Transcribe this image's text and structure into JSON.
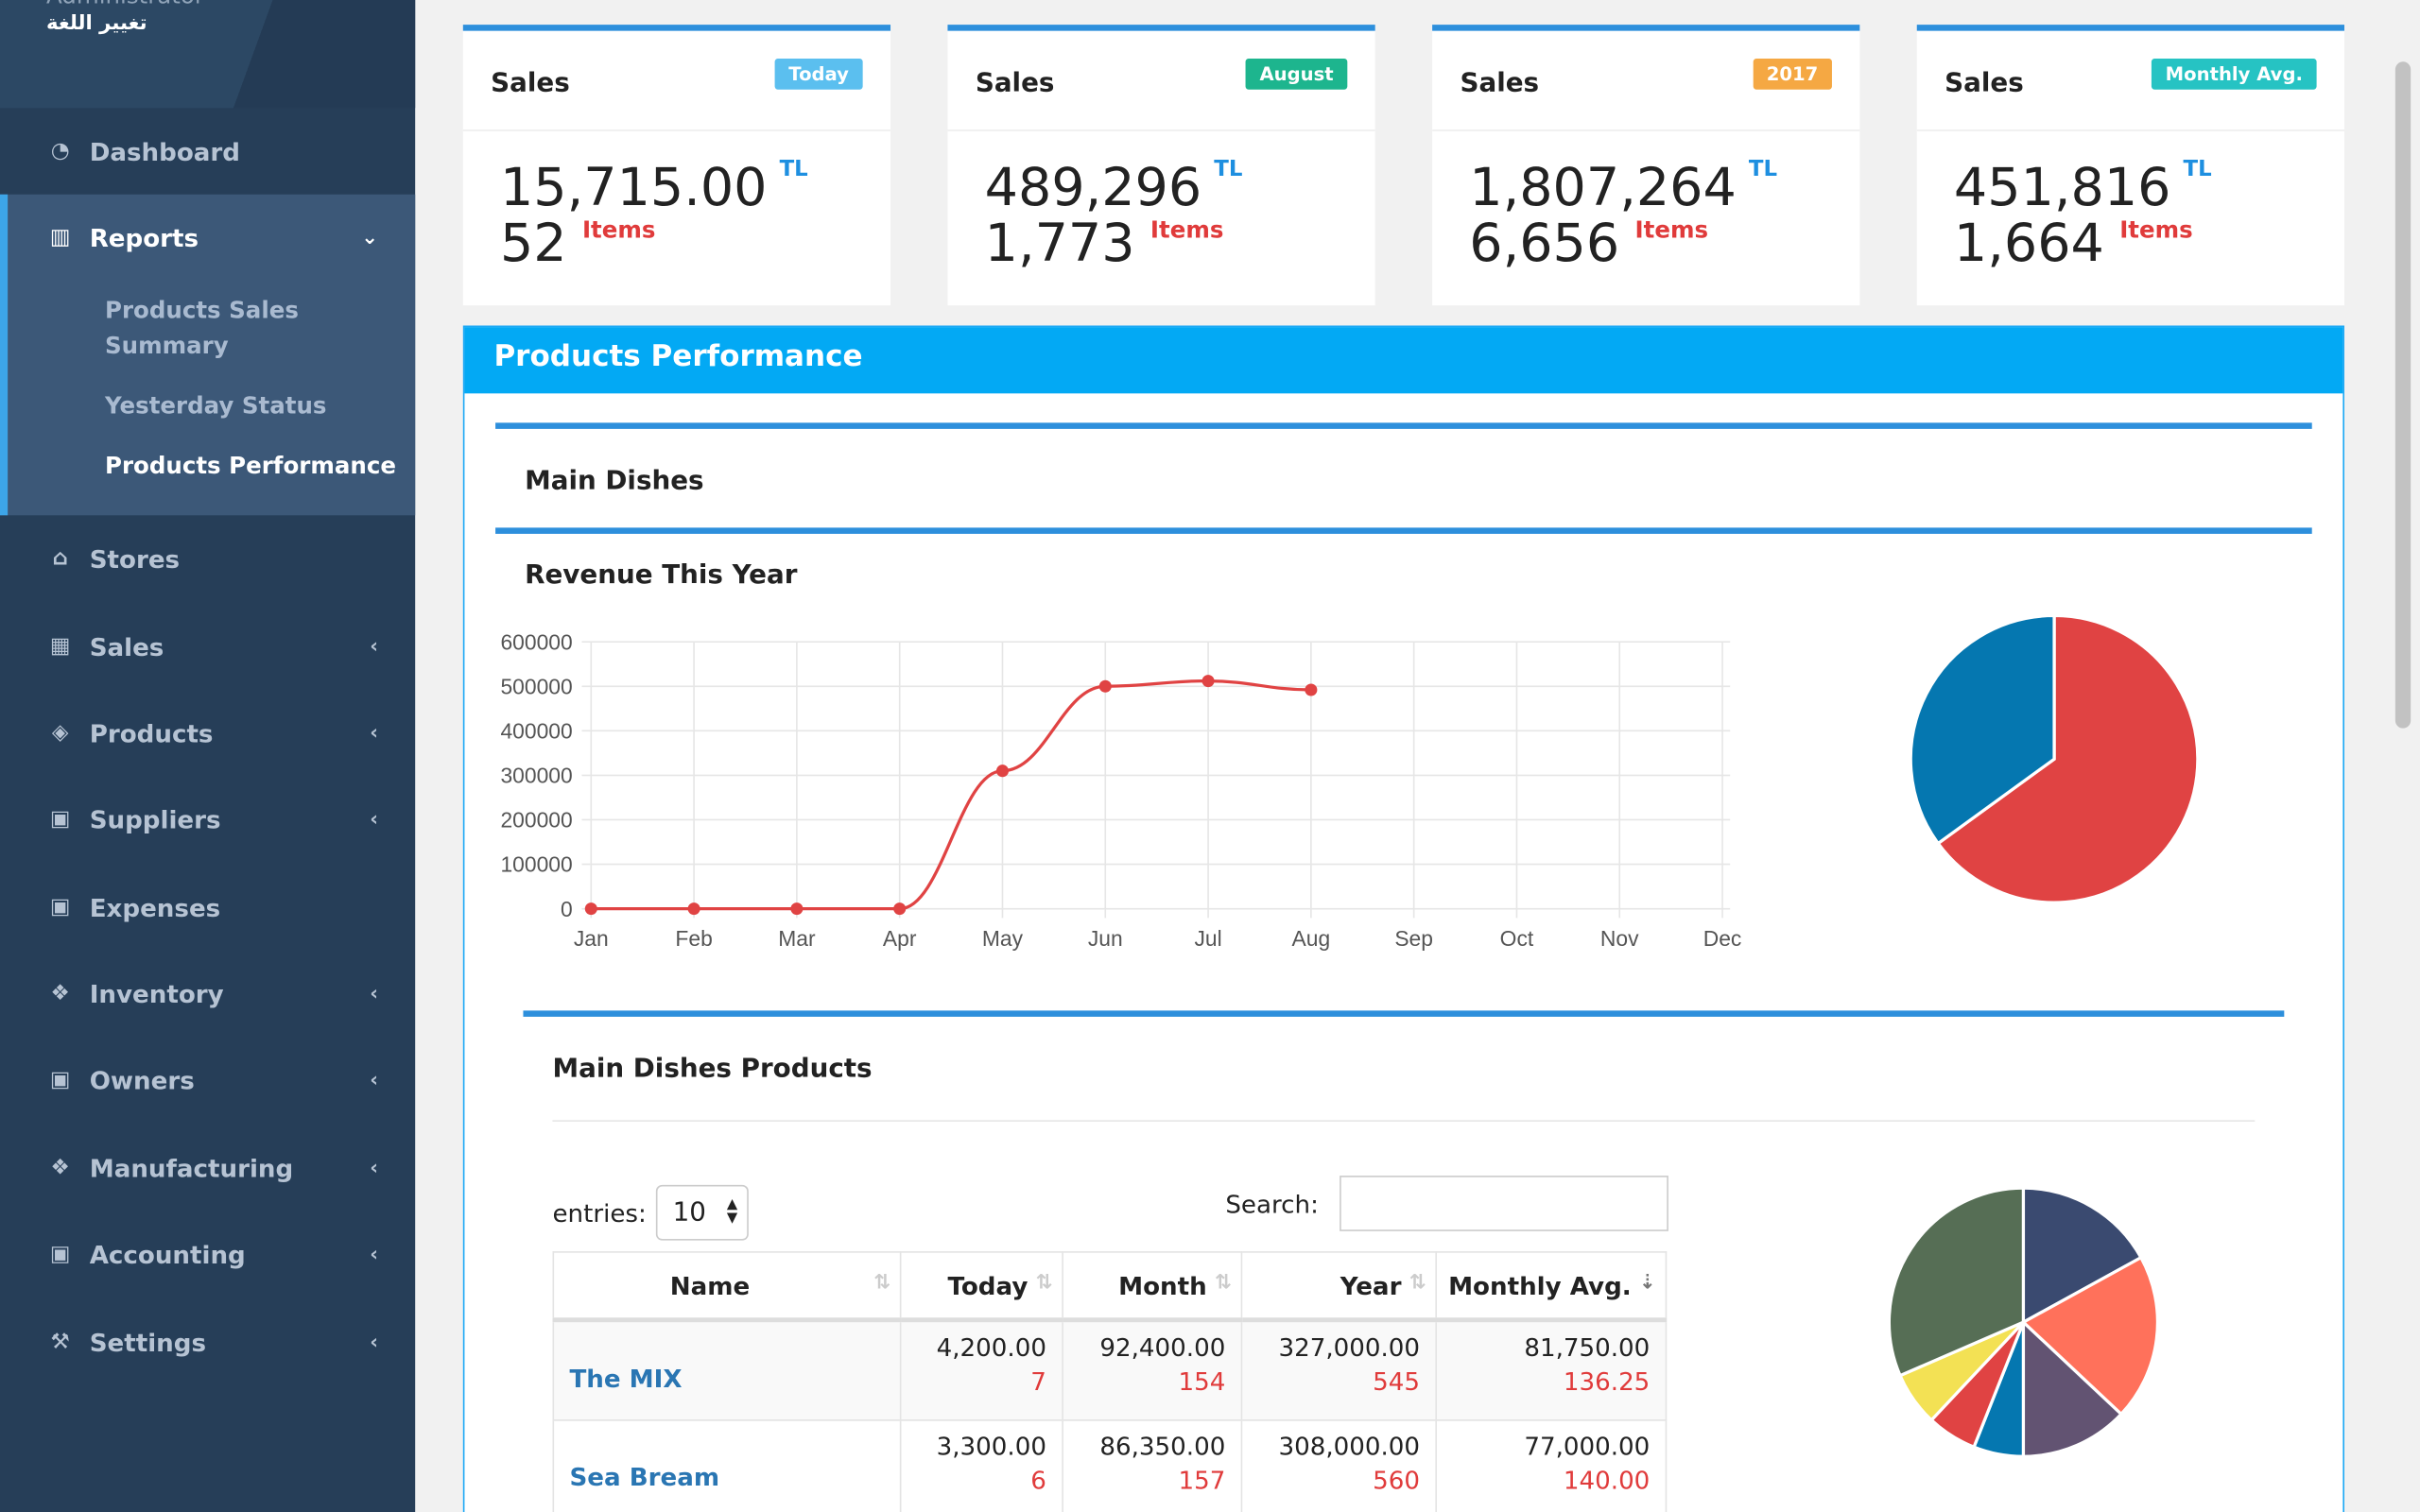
{
  "sidebar": {
    "user": "Administrator",
    "language": "تغيير اللغة",
    "items": [
      {
        "label": "Dashboard",
        "icon": "dashboard-icon"
      },
      {
        "label": "Reports",
        "icon": "bar-chart-icon"
      },
      {
        "label": "Stores",
        "icon": "home-icon"
      },
      {
        "label": "Sales",
        "icon": "calculator-icon"
      },
      {
        "label": "Products",
        "icon": "tags-icon"
      },
      {
        "label": "Suppliers",
        "icon": "money-icon"
      },
      {
        "label": "Expenses",
        "icon": "money-icon"
      },
      {
        "label": "Inventory",
        "icon": "cubes-icon"
      },
      {
        "label": "Owners",
        "icon": "money-icon"
      },
      {
        "label": "Manufacturing",
        "icon": "cubes-icon"
      },
      {
        "label": "Accounting",
        "icon": "money-icon"
      },
      {
        "label": "Settings",
        "icon": "wrench-icon"
      }
    ],
    "report_subitems": [
      "Products Sales Summary",
      "Yesterday Status",
      "Products Performance"
    ]
  },
  "cards": [
    {
      "title": "Sales",
      "badge": "Today",
      "badge_color": "#5bbfef",
      "amount": "15,715.00",
      "currency": "TL",
      "count": "52",
      "count_label": "Items"
    },
    {
      "title": "Sales",
      "badge": "August",
      "badge_color": "#1db58e",
      "amount": "489,296",
      "currency": "TL",
      "count": "1,773",
      "count_label": "Items"
    },
    {
      "title": "Sales",
      "badge": "2017",
      "badge_color": "#f5a843",
      "amount": "1,807,264",
      "currency": "TL",
      "count": "6,656",
      "count_label": "Items"
    },
    {
      "title": "Sales",
      "badge": "Monthly Avg.",
      "badge_color": "#26c3c3",
      "amount": "451,816",
      "currency": "TL",
      "count": "1,664",
      "count_label": "Items"
    }
  ],
  "panel": {
    "title": "Products Performance",
    "section": "Main Dishes",
    "chart_title": "Revenue This Year",
    "products_title": "Main Dishes Products"
  },
  "chart_data": [
    {
      "type": "line",
      "categories": [
        "Jan",
        "Feb",
        "Mar",
        "Apr",
        "May",
        "Jun",
        "Jul",
        "Aug",
        "Sep",
        "Oct",
        "Nov",
        "Dec"
      ],
      "values": [
        0,
        0,
        0,
        0,
        310000,
        500000,
        512000,
        492000,
        null,
        null,
        null,
        null
      ],
      "ylim": [
        0,
        600000
      ],
      "yticks": [
        0,
        100000,
        200000,
        300000,
        400000,
        500000,
        600000
      ],
      "color": "#e04343",
      "grid": true
    },
    {
      "type": "pie",
      "values": [
        0.65,
        0.35
      ],
      "colors": [
        "#e04343",
        "#0577b0"
      ]
    },
    {
      "type": "pie",
      "values": [
        0.17,
        0.2,
        0.13,
        0.06,
        0.06,
        0.065,
        0.315
      ],
      "colors": [
        "#3a4a70",
        "#ff715b",
        "#625372",
        "#0577b0",
        "#e04343",
        "#f3e154",
        "#566e55"
      ]
    }
  ],
  "table": {
    "entries_label": "entries:",
    "entries_value": "10",
    "search_label": "Search:",
    "search_value": "",
    "columns": [
      "Name",
      "Today",
      "Month",
      "Year",
      "Monthly Avg."
    ],
    "rows": [
      {
        "name": "The MIX",
        "today": "4,200.00",
        "today_n": "7",
        "month": "92,400.00",
        "month_n": "154",
        "year": "327,000.00",
        "year_n": "545",
        "avg": "81,750.00",
        "avg_n": "136.25"
      },
      {
        "name": "Sea Bream",
        "today": "3,300.00",
        "today_n": "6",
        "month": "86,350.00",
        "month_n": "157",
        "year": "308,000.00",
        "year_n": "560",
        "avg": "77,000.00",
        "avg_n": "140.00"
      }
    ]
  }
}
